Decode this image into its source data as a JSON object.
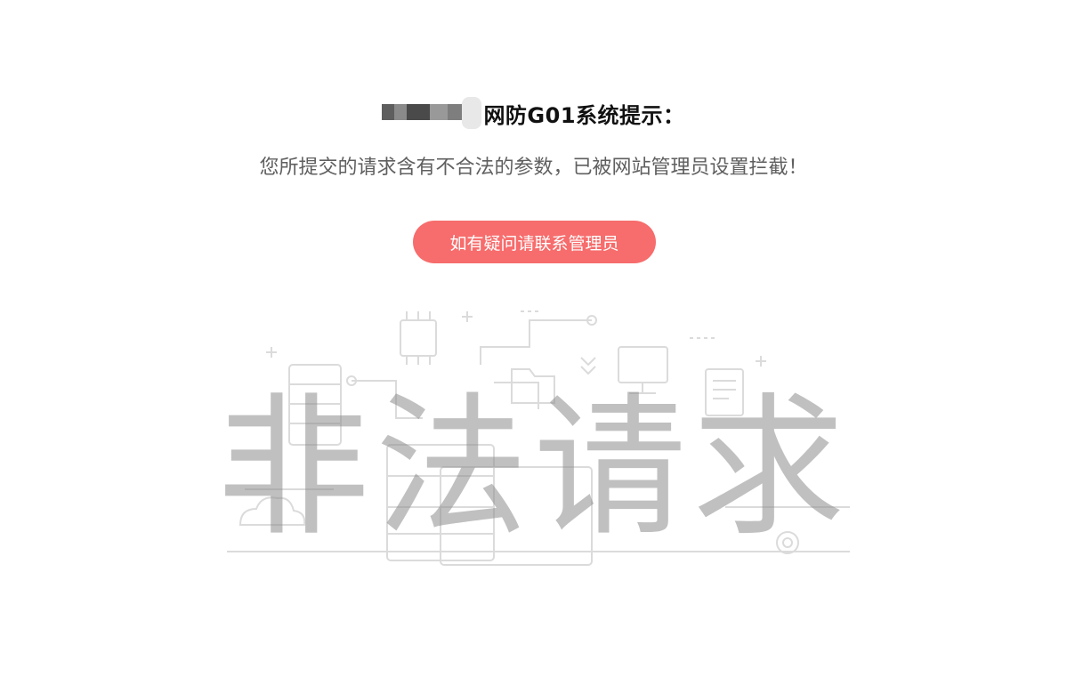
{
  "header": {
    "title": "网防G01系统提示："
  },
  "message": {
    "text": "您所提交的请求含有不合法的参数，已被网站管理员设置拦截！"
  },
  "contact_button": {
    "label": "如有疑问请联系管理员"
  },
  "banner": {
    "text": "非法请求"
  },
  "colors": {
    "button": "#f76c6c",
    "title": "#111111",
    "message": "#5f5f5f"
  }
}
